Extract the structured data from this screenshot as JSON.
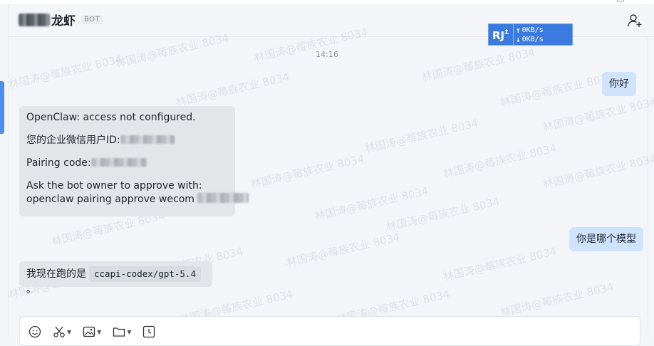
{
  "header": {
    "title_suffix": "龙虾",
    "badge": "BOT",
    "add_member_icon": "add-member-icon"
  },
  "network_monitor": {
    "upload": "0KB/s",
    "download": "0KB/s"
  },
  "chat": {
    "timestamp": "14:16",
    "watermark": "林国涛@莓族农业 8034",
    "messages": {
      "user_hello": "你好",
      "bot_reply_1": {
        "line1": "OpenClaw: access not configured.",
        "line2": "您的企业微信用户ID:",
        "line3": "Pairing code:",
        "line4": "Ask the bot owner to approve with:",
        "line5": "openclaw pairing approve wecom"
      },
      "user_model_question": "你是哪个模型",
      "bot_reply_2": {
        "prefix": "我现在跑的是",
        "model": "ccapi-codex/gpt-5.4",
        "suffix": "。"
      }
    }
  },
  "composer": {
    "tools": [
      "emoji-icon",
      "scissors-icon",
      "image-icon",
      "folder-icon",
      "clock-icon"
    ]
  },
  "colors": {
    "user_bubble": "#cfe4fc",
    "bot_bubble": "#e3e5e9",
    "accent": "#4b8ff2",
    "background": "#f3f5f9"
  }
}
